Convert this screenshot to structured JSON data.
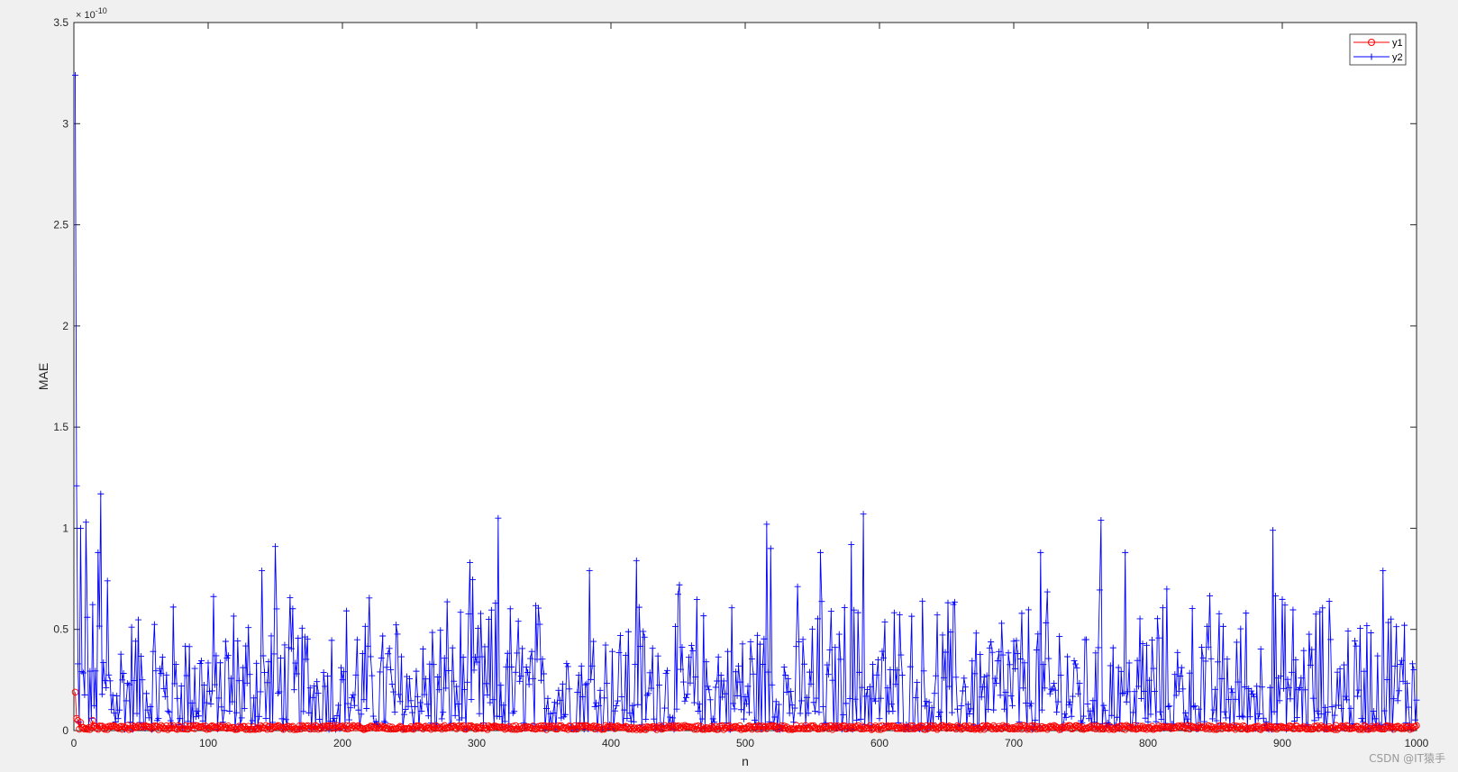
{
  "chart_data": {
    "type": "line",
    "title": "",
    "xlabel": "n",
    "ylabel": "MAE",
    "exponent_base": "× 10",
    "exponent_power": "-10",
    "xlim": [
      0,
      1000
    ],
    "ylim": [
      0,
      3.5
    ],
    "y_scale": 1e-10,
    "x_ticks": [
      0,
      100,
      200,
      300,
      400,
      500,
      600,
      700,
      800,
      900,
      1000
    ],
    "y_ticks": [
      0,
      0.5,
      1,
      1.5,
      2,
      2.5,
      3,
      3.5
    ],
    "x_tick_labels": [
      "0",
      "100",
      "200",
      "300",
      "400",
      "500",
      "600",
      "700",
      "800",
      "900",
      "1000"
    ],
    "y_tick_labels": [
      "0",
      "0.5",
      "1",
      "1.5",
      "2",
      "2.5",
      "3",
      "3.5"
    ],
    "grid": false,
    "legend_position": "top-right",
    "n_points": 1000,
    "series": [
      {
        "name": "y1",
        "color": "#ff0000",
        "marker": "circle",
        "values_note_visible": false,
        "peaks": [
          {
            "x": 1,
            "y": 0.19
          },
          {
            "x": 2,
            "y": 0.06
          },
          {
            "x": 3,
            "y": 0.05
          },
          {
            "x": 5,
            "y": 0.04
          },
          {
            "x": 14,
            "y": 0.05
          }
        ],
        "typical_level": 0.015,
        "typical_spread": 0.03
      },
      {
        "name": "y2",
        "color": "#0000ff",
        "marker": "plus",
        "peaks": [
          {
            "x": 1,
            "y": 3.24
          },
          {
            "x": 2,
            "y": 1.21
          },
          {
            "x": 5,
            "y": 1.0
          },
          {
            "x": 9,
            "y": 1.03
          },
          {
            "x": 18,
            "y": 0.88
          },
          {
            "x": 20,
            "y": 1.17
          },
          {
            "x": 25,
            "y": 0.74
          },
          {
            "x": 150,
            "y": 0.91
          },
          {
            "x": 140,
            "y": 0.79
          },
          {
            "x": 295,
            "y": 0.83
          },
          {
            "x": 316,
            "y": 1.05
          },
          {
            "x": 384,
            "y": 0.79
          },
          {
            "x": 419,
            "y": 0.84
          },
          {
            "x": 516,
            "y": 1.02
          },
          {
            "x": 519,
            "y": 0.9
          },
          {
            "x": 556,
            "y": 0.88
          },
          {
            "x": 579,
            "y": 0.92
          },
          {
            "x": 588,
            "y": 1.07
          },
          {
            "x": 720,
            "y": 0.88
          },
          {
            "x": 765,
            "y": 1.04
          },
          {
            "x": 783,
            "y": 0.88
          },
          {
            "x": 893,
            "y": 0.99
          },
          {
            "x": 975,
            "y": 0.79
          }
        ],
        "typical_level": 0.22,
        "typical_spread": 0.55
      }
    ]
  },
  "watermark": "CSDN @IT猿手"
}
